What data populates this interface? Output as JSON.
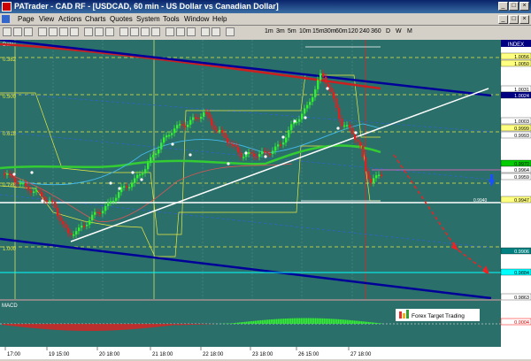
{
  "window": {
    "title": "PATrader - CAD RF - [USDCAD, 60 min - US Dollar vs Canadian Dollar]"
  },
  "menu": [
    "Page",
    "View",
    "Actions",
    "Charts",
    "Quotes",
    "System",
    "Tools",
    "Window",
    "Help"
  ],
  "timeframes": [
    "1m",
    "3m",
    "5m",
    "10m",
    "15m",
    "30m",
    "60m",
    "120",
    "240",
    "360",
    "D",
    "W",
    "M"
  ],
  "chart": {
    "left_label": "Data",
    "index_label": "INDEX",
    "left_levels": [
      "0.382",
      "0.500",
      "0.618",
      "0.786",
      "1.000"
    ],
    "right_prices": [
      {
        "text": "1.0056",
        "bg": "#ffff80",
        "fg": "#000"
      },
      {
        "text": "1.0050",
        "bg": "#ffff80",
        "fg": "#000"
      },
      {
        "text": "1.0031",
        "bg": "#ffffff",
        "fg": "#000"
      },
      {
        "text": "1.0024",
        "bg": "#000080",
        "fg": "#fff"
      },
      {
        "text": "1.0003",
        "bg": "#ffffff",
        "fg": "#000"
      },
      {
        "text": "0.9999",
        "bg": "#ffff80",
        "fg": "#000"
      },
      {
        "text": "0.9993",
        "bg": "#ffffff",
        "fg": "#000"
      },
      {
        "text": "0.9970",
        "bg": "#00cc00",
        "fg": "#000"
      },
      {
        "text": "0.9964",
        "bg": "#ffffff",
        "fg": "#000"
      },
      {
        "text": "0.9959",
        "bg": "#ffffff",
        "fg": "#000"
      },
      {
        "text": "0.9947",
        "bg": "#ffff80",
        "fg": "#000"
      },
      {
        "text": "0.9906",
        "bg": "#008080",
        "fg": "#fff"
      },
      {
        "text": "0.9884",
        "bg": "#00ffff",
        "fg": "#000"
      },
      {
        "text": "0.9863",
        "bg": "#ffffff",
        "fg": "#000"
      }
    ],
    "inline_price": "0.9940",
    "macd_label": "MACD",
    "macd_price": "0.0004",
    "watermark": "Forex Target Trading",
    "time_labels": [
      "17:00",
      "19 15:00",
      "20 18:00",
      "21 18:00",
      "22 18:00",
      "23 18:00",
      "26 15:00",
      "27 18:00"
    ]
  },
  "colors": {
    "chart_bg": "#2b6f6a",
    "channel": "#000099",
    "ma_red": "#cc2020",
    "ma_green": "#33cc33",
    "trendline": "#ffffff",
    "fib": "#e8e840"
  }
}
